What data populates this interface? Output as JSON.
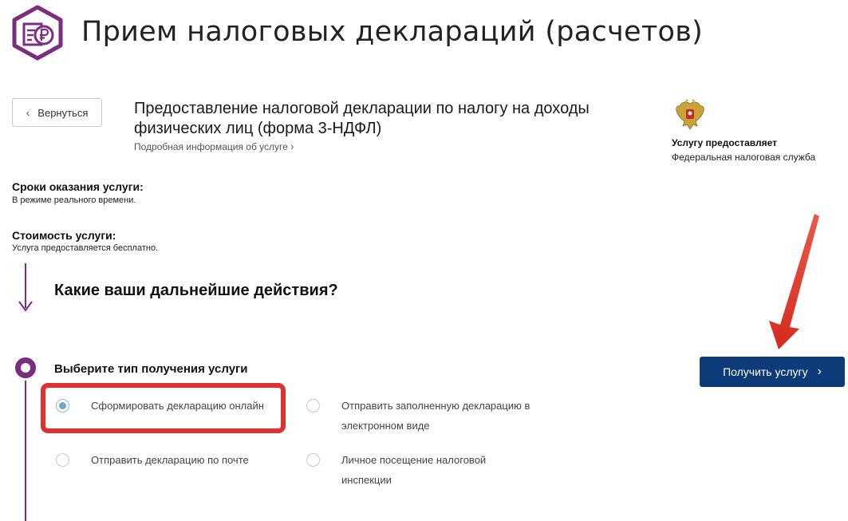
{
  "header": {
    "title": "Прием налоговых деклараций (расчетов)",
    "logo_icon": "tax-declaration-ruble-icon",
    "logo_color": "#7b2d7f"
  },
  "nav": {
    "back_label": "Вернуться",
    "back_icon": "chevron-left-icon"
  },
  "service": {
    "title_line1": "Предоставление налоговой декларации по налогу на доходы",
    "title_line2": "физических лиц (форма 3-НДФЛ)",
    "more_info_link": "Подробная информация об услуге",
    "more_info_icon": "chevron-right-icon"
  },
  "provider": {
    "label": "Услугу предоставляет",
    "name": "Федеральная налоговая служба",
    "emblem_icon": "russian-emblem-icon"
  },
  "terms": {
    "heading": "Сроки оказания услуги:",
    "text": "В режиме реального времени."
  },
  "cost": {
    "heading": "Стоимость услуги:",
    "text": "Услуга предоставляется бесплатно."
  },
  "next_steps": {
    "heading": "Какие ваши дальнейшие действия?"
  },
  "receive_type": {
    "label": "Выберите тип получения услуги",
    "options": [
      {
        "label": "Сформировать декларацию онлайн",
        "selected": true
      },
      {
        "label_line1": "Отправить заполненную декларацию в",
        "label_line2": "электронном виде",
        "selected": false
      },
      {
        "label": "Отправить декларацию по почте",
        "selected": false
      },
      {
        "label_line1": "Личное посещение налоговой",
        "label_line2": "инспекции",
        "selected": false
      }
    ]
  },
  "cta": {
    "label": "Получить услугу",
    "icon": "chevron-right-icon",
    "color": "#0d3a78"
  },
  "annotation": {
    "highlight_color": "#e03131",
    "arrow_color": "#e03131"
  }
}
